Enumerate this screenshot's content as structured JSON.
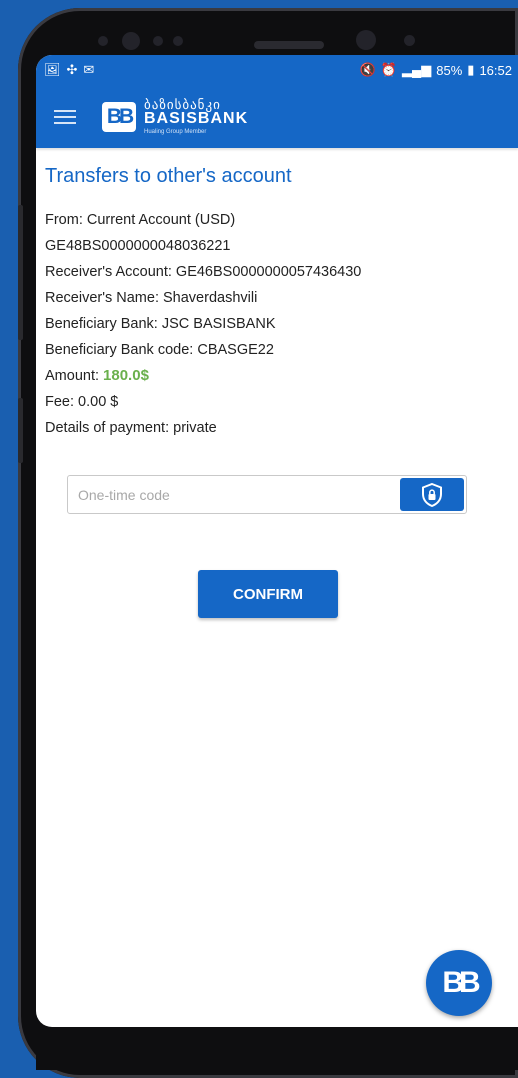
{
  "statusbar": {
    "battery": "85%",
    "time": "16:52"
  },
  "appbar": {
    "logo_mark": "BB",
    "logo_geo": "ბაზისბანკი",
    "logo_name": "BASISBANK",
    "logo_sub": "Hualing Group Member"
  },
  "transfer": {
    "title": "Transfers to other's account",
    "from_label": "From:",
    "from_value": "Current Account (USD)",
    "from_iban": "GE48BS0000000048036221",
    "receiver_account_label": "Receiver's Account:",
    "receiver_account_value": "GE46BS0000000057436430",
    "receiver_name_label": "Receiver's Name:",
    "receiver_name_value": "Shaverdashvili",
    "beneficiary_bank_label": "Beneficiary Bank:",
    "beneficiary_bank_value": "JSC BASISBANK",
    "beneficiary_code_label": "Beneficiary Bank code:",
    "beneficiary_code_value": "CBASGE22",
    "amount_label": "Amount:",
    "amount_value": "180.0$",
    "fee_label": "Fee:",
    "fee_value": "0.00 $",
    "details_label": "Details of payment:",
    "details_value": "private"
  },
  "otp": {
    "placeholder": "One-time code"
  },
  "confirm_label": "CONFIRM",
  "fab_mark": "BB",
  "colors": {
    "brand": "#1567c6",
    "amount": "#6ab04c",
    "background": "#1a5fb0"
  }
}
